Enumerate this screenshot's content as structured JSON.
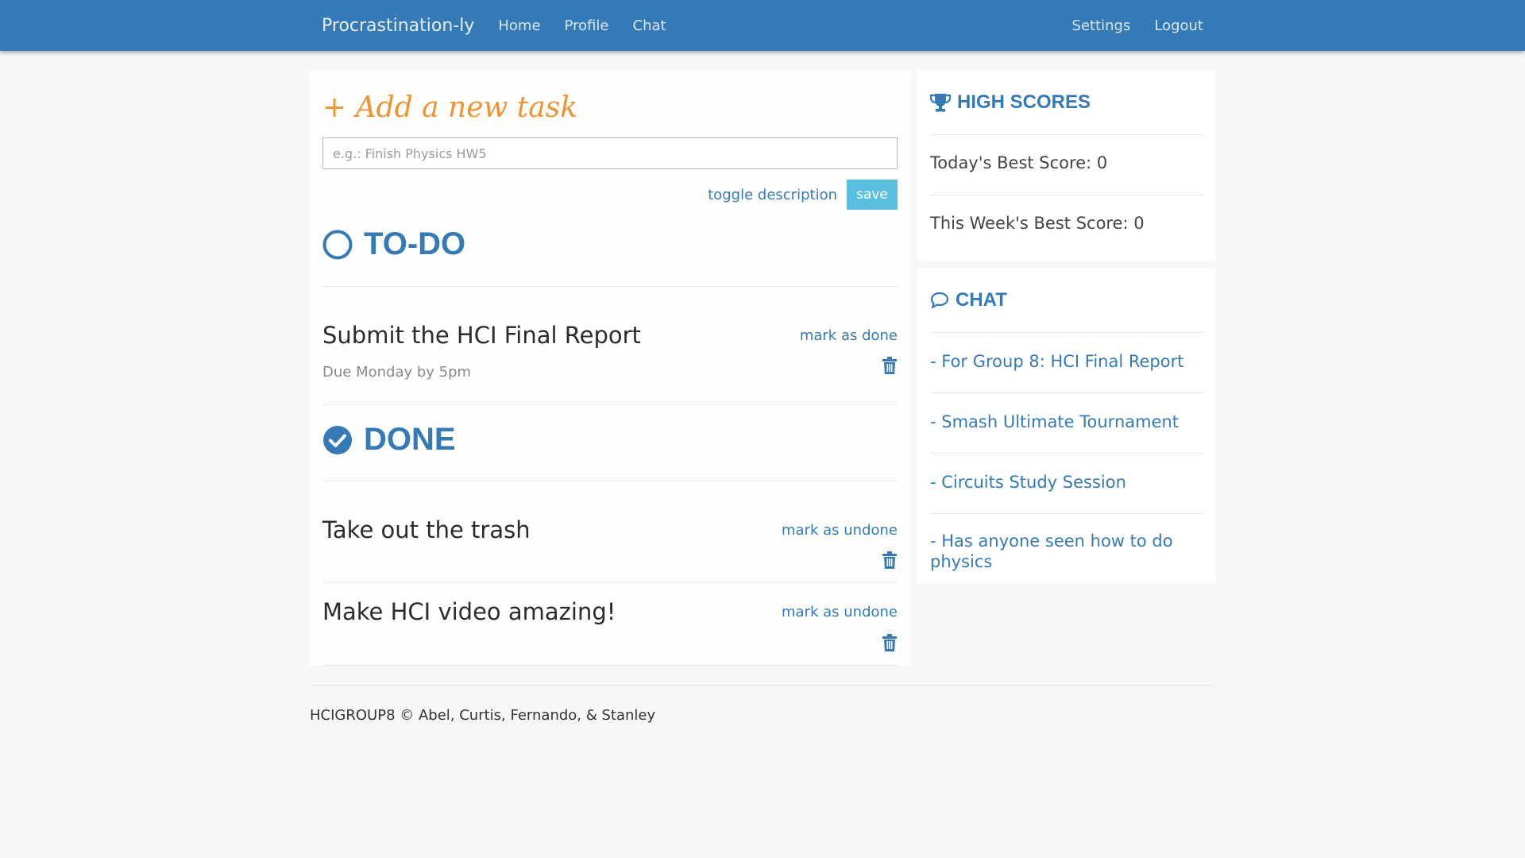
{
  "nav": {
    "brand": "Procrastination-ly",
    "links": [
      "Home",
      "Profile",
      "Chat"
    ],
    "right_links": [
      "Settings",
      "Logout"
    ]
  },
  "add_task": {
    "title": "+ Add a new task",
    "placeholder": "e.g.: Finish Physics HW5",
    "toggle_label": "toggle description",
    "save_label": "save"
  },
  "todo": {
    "heading": "TO-DO",
    "tasks": [
      {
        "title": "Submit the HCI Final Report",
        "description": "Due Monday by 5pm",
        "action": "mark as done"
      }
    ]
  },
  "done": {
    "heading": "DONE",
    "tasks": [
      {
        "title": "Take out the trash",
        "action": "mark as undone"
      },
      {
        "title": "Make HCI video amazing!",
        "action": "mark as undone"
      }
    ]
  },
  "high_scores": {
    "heading": "HIGH SCORES",
    "icon": "trophy-icon",
    "today": "Today's Best Score: 0",
    "week": "This Week's Best Score: 0"
  },
  "chat": {
    "heading": "CHAT",
    "icon": "speech-bubble-icon",
    "rooms": [
      "- For Group 8: HCI Final Report",
      "- Smash Ultimate Tournament",
      "- Circuits Study Session",
      "- Has anyone seen how to do physics"
    ]
  },
  "footer": {
    "text": "HCIGROUP8 © Abel, Curtis, Fernando, & Stanley"
  },
  "colors": {
    "primary": "#337ab7",
    "accent": "#f0922d",
    "save_button": "#5bc0de",
    "background": "#f7f7f7"
  }
}
